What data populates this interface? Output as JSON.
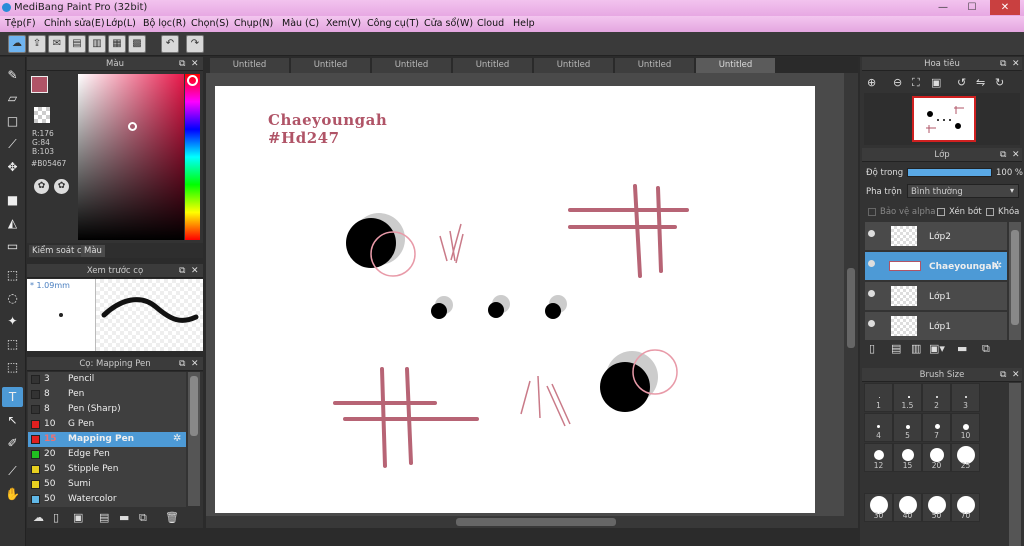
{
  "window": {
    "title": "MediBang Paint Pro (32bit)",
    "minimize": "—",
    "maximize": "☐",
    "close": "✕"
  },
  "menu": [
    "Tệp(F)",
    "Chỉnh sửa(E)",
    "Lớp(L)",
    "Bộ lọc(R)",
    "Chọn(S)",
    "Chụp(N)",
    "Màu (C)",
    "Xem(V)",
    "Công cụ(T)",
    "Cửa sổ(W)",
    "Cloud",
    "Help"
  ],
  "color_panel": {
    "title": "Màu",
    "r": "R:176",
    "g": "G:84",
    "b": "B:103",
    "hex": "#B05467",
    "tab_brush_control": "Kiểm soát cọ",
    "tab_color": "Màu",
    "current_color": "#b05467"
  },
  "brush_preview": {
    "title": "Xem trước cọ",
    "size": "* 1.09mm"
  },
  "brush_list": {
    "title": "Cọ: Mapping Pen",
    "items": [
      {
        "size": "3",
        "name": "Pencil",
        "color": "#333333"
      },
      {
        "size": "8",
        "name": "Pen",
        "color": "#333333"
      },
      {
        "size": "8",
        "name": "Pen (Sharp)",
        "color": "#333333"
      },
      {
        "size": "10",
        "name": "G Pen",
        "color": "#e02020"
      },
      {
        "size": "15",
        "name": "Mapping Pen",
        "color": "#e02020",
        "selected": true
      },
      {
        "size": "20",
        "name": "Edge Pen",
        "color": "#20c020"
      },
      {
        "size": "50",
        "name": "Stipple Pen",
        "color": "#e8d020"
      },
      {
        "size": "50",
        "name": "Sumi",
        "color": "#e8d020"
      },
      {
        "size": "50",
        "name": "Watercolor",
        "color": "#60b8e8"
      }
    ]
  },
  "tabs": [
    "Untitled",
    "Untitled",
    "Untitled",
    "Untitled",
    "Untitled",
    "Untitled",
    "Untitled"
  ],
  "active_tab_index": 6,
  "canvas": {
    "text_line1": "Chaeyoungah",
    "text_line2": "#Hd247",
    "text_color": "#b05467"
  },
  "navigator": {
    "title": "Hoa tiêu"
  },
  "layer_panel": {
    "title": "Lớp",
    "opacity_label": "Độ trong",
    "opacity_value": "100 %",
    "blend_label": "Pha trộn",
    "blend_value": "Bình thường",
    "protect_alpha": "Bảo vệ alpha",
    "clipping": "Xén bớt",
    "lock": "Khóa",
    "layers": [
      {
        "name": "Lớp2",
        "selected": false
      },
      {
        "name": "Chaeyoungah",
        "selected": true
      },
      {
        "name": "Lớp1",
        "selected": false
      },
      {
        "name": "Lớp1",
        "selected": false
      }
    ]
  },
  "brush_size": {
    "title": "Brush Size",
    "sizes": [
      "1",
      "1.5",
      "2",
      "3",
      "4",
      "5",
      "7",
      "10",
      "12",
      "15",
      "20",
      "25",
      "30",
      "40",
      "50",
      "70"
    ]
  }
}
